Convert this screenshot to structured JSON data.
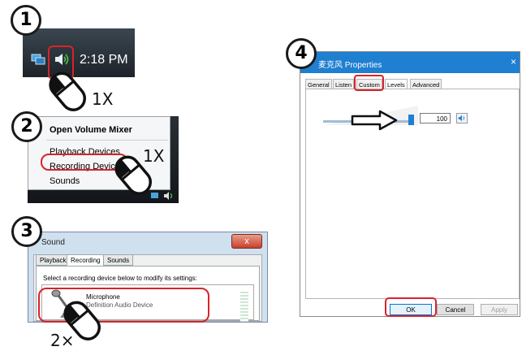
{
  "steps": [
    {
      "number": "1"
    },
    {
      "number": "2"
    },
    {
      "number": "3"
    },
    {
      "number": "4"
    }
  ],
  "step1": {
    "time": "2:18 PM",
    "click_label": "1X",
    "icons": [
      "network-icon",
      "volume-icon",
      "mouse-icon"
    ]
  },
  "step2": {
    "menu_items": [
      "Open Volume Mixer",
      "Playback Devices",
      "Recording Devices",
      "Sounds"
    ],
    "click_label": "1X"
  },
  "step3": {
    "window_title": "Sound",
    "close_label": "x",
    "tabs": [
      "Playback",
      "Recording",
      "Sounds"
    ],
    "active_tab": "Recording",
    "instruction": "Select a recording device below to modify its settings:",
    "device": {
      "name": "Microphone",
      "description": "Definition Audio Device"
    },
    "click_label": "2×"
  },
  "step4": {
    "window_title": "麦克风 Properties",
    "close_label": "×",
    "tabs": [
      "General",
      "Listen",
      "Custom",
      "Levels",
      "Advanced"
    ],
    "active_tab": "Levels",
    "level_value": "100",
    "level_fraction": 1.0,
    "buttons": {
      "ok": "OK",
      "cancel": "Cancel",
      "apply": "Apply"
    }
  },
  "colors": {
    "highlight": "#d8232a",
    "accent": "#1f7fd0"
  }
}
